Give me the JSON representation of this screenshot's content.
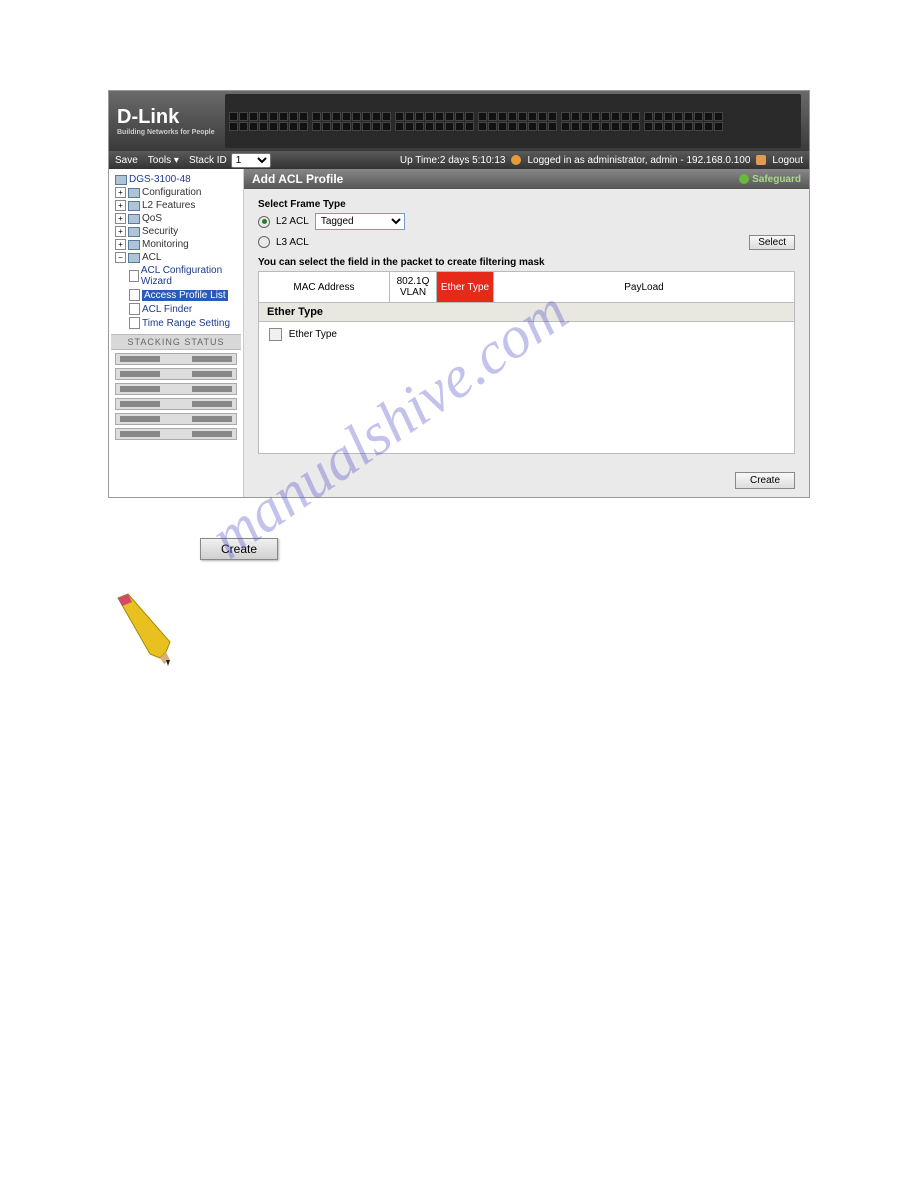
{
  "logo": {
    "main": "D-Link",
    "tagline": "Building Networks for People"
  },
  "menu": {
    "save": "Save",
    "tools": "Tools ▾",
    "stack_id_label": "Stack ID",
    "stack_id_value": "1",
    "uptime": "Up Time:2 days 5:10:13",
    "logged_in": "Logged in as administrator, admin - 192.168.0.100",
    "logout": "Logout"
  },
  "device_model": "DGS-3100-48",
  "tree": {
    "configuration": "Configuration",
    "l2_features": "L2 Features",
    "qos": "QoS",
    "security": "Security",
    "monitoring": "Monitoring",
    "acl": "ACL",
    "acl_wizard": "ACL Configuration Wizard",
    "access_profile_list": "Access Profile List",
    "acl_finder": "ACL Finder",
    "time_range": "Time Range Setting"
  },
  "stacking_status_label": "STACKING STATUS",
  "pane": {
    "title": "Add ACL Profile",
    "safeguard": "Safeguard",
    "select_frame_type": "Select Frame Type",
    "l2_acl": "L2 ACL",
    "l3_acl": "L3 ACL",
    "frame_dropdown": "Tagged",
    "select_btn": "Select",
    "hint": "You can select the field in the packet to create filtering mask",
    "tabs": {
      "mac": "MAC Address",
      "vlan": "802.1Q VLAN",
      "ether": "Ether Type",
      "payload": "PayLoad"
    },
    "field_header": "Ether Type",
    "ether_checkbox": "Ether Type",
    "create": "Create"
  },
  "standalone_create": "Create",
  "watermark": "manualshive.com"
}
